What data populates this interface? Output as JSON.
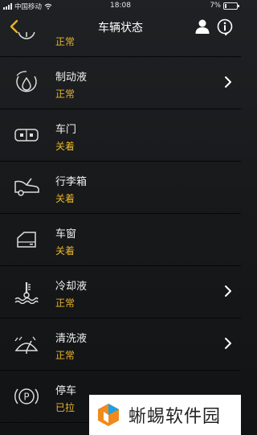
{
  "status_bar": {
    "carrier": "中国移动",
    "time": "18:08",
    "battery": "7%"
  },
  "nav": {
    "title": "车辆状态",
    "icons": [
      "back-icon",
      "user-icon",
      "info-icon"
    ]
  },
  "rows": [
    {
      "label": "",
      "status": "正常",
      "icon": "tire-pressure-icon",
      "has_arrow": true
    },
    {
      "label": "制动液",
      "status": "正常",
      "icon": "brake-fluid-icon",
      "has_arrow": true
    },
    {
      "label": "车门",
      "status": "关着",
      "icon": "door-icon",
      "has_arrow": false
    },
    {
      "label": "行李箱",
      "status": "关着",
      "icon": "trunk-icon",
      "has_arrow": false
    },
    {
      "label": "车窗",
      "status": "关着",
      "icon": "window-icon",
      "has_arrow": false
    },
    {
      "label": "冷却液",
      "status": "正常",
      "icon": "coolant-icon",
      "has_arrow": true
    },
    {
      "label": "清洗液",
      "status": "正常",
      "icon": "washer-fluid-icon",
      "has_arrow": true
    },
    {
      "label": "停车",
      "status": "已拉",
      "icon": "parking-brake-icon",
      "has_arrow": false
    }
  ],
  "colors": {
    "status_text": "#e6b42a",
    "back_arrow": "#e6b42a",
    "background": "#1a1c1e"
  },
  "watermark": {
    "text": "蜥蜴软件园"
  }
}
